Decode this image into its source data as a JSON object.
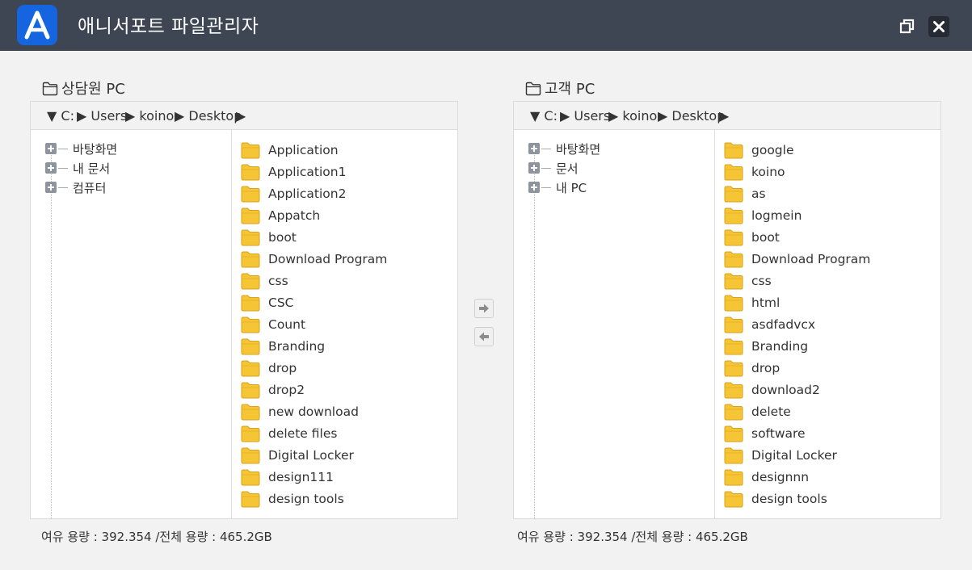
{
  "app": {
    "title": "애니서포트 파일관리자",
    "logo_letter": "A",
    "accent_color": "#1565e0",
    "titlebar_color": "#3e4553"
  },
  "window_controls": [
    "restore-icon",
    "close-icon"
  ],
  "left_panel": {
    "title": "상담원 PC",
    "path": [
      "▼ C:",
      "▶ Users",
      "▶ koino",
      "▶ Desktop",
      "▶"
    ],
    "tree": [
      "바탕화면",
      "내 문서",
      "컴퓨터"
    ],
    "files": [
      "Application",
      "Application1",
      "Application2",
      "Appatch",
      "boot",
      "Download Program",
      "css",
      "CSC",
      "Count",
      "Branding",
      "drop",
      "drop2",
      "new download",
      "delete files",
      "Digital Locker",
      "design111",
      "design tools"
    ],
    "storage": "여유 용량 : 392.354 /전체 용량 : 465.2GB"
  },
  "right_panel": {
    "title": "고객 PC",
    "path": [
      "▼ C:",
      "▶ Users",
      "▶ koino",
      "▶ Desktop",
      "▶"
    ],
    "tree": [
      "바탕화면",
      "문서",
      "내 PC"
    ],
    "files": [
      "google",
      "koino",
      "as",
      "logmein",
      "boot",
      "Download Program",
      "css",
      "html",
      "asdfadvcx",
      "Branding",
      "drop",
      "download2",
      "delete",
      "software",
      "Digital Locker",
      "designnn",
      "design tools"
    ],
    "storage": "여유 용량 : 392.354 /전체 용량 : 465.2GB"
  },
  "transfer": [
    "arrow-right-icon",
    "arrow-left-icon"
  ]
}
